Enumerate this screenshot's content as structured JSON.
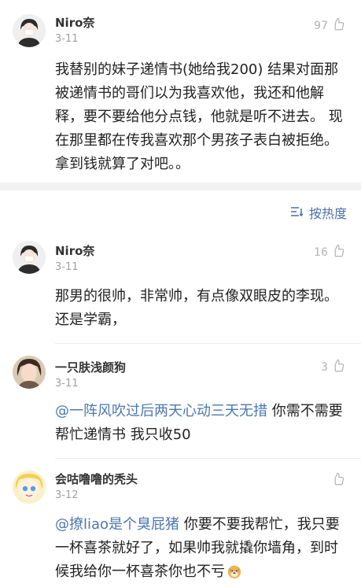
{
  "comments": [
    {
      "name": "Niro奈",
      "date": "3-11",
      "likes": "97",
      "mention": "",
      "text": "我替别的妹子递情书(她给我200) 结果对面那被递情书的哥们以为我喜欢他，我还和他解释，要不要给他分点钱，他就是听不进去。 现在那里都在传我喜欢那个男孩子表白被拒绝。 拿到钱就算了对吧。。"
    },
    {
      "name": "Niro奈",
      "date": "3-11",
      "likes": "16",
      "mention": "",
      "text": "那男的很帅，非常帅，有点像双眼皮的李现。还是学霸，"
    },
    {
      "name": "一只肤浅颜狗",
      "date": "3-11",
      "likes": "3",
      "mention": "@一阵风吹过后两天心动三天无措",
      "text": " 你需不需要帮忙递情书 我只收50"
    },
    {
      "name": "会咕噜噜的秃头",
      "date": "3-12",
      "likes": "",
      "mention": "@撩liao是个臭屁猪",
      "text": " 你要不要我帮忙，我只要一杯喜茶就好了，如果帅我就撬你墙角，到时候我给你一杯喜茶你也不亏"
    }
  ],
  "sort": {
    "label": "按热度"
  },
  "icons": {
    "like": "thumbs-up-icon",
    "sort": "sort-icon",
    "emoji": "doge-emoji-icon"
  },
  "colors": {
    "link": "#4c77b0",
    "meta": "#a0a0a0",
    "divider": "#f2f2f2"
  }
}
